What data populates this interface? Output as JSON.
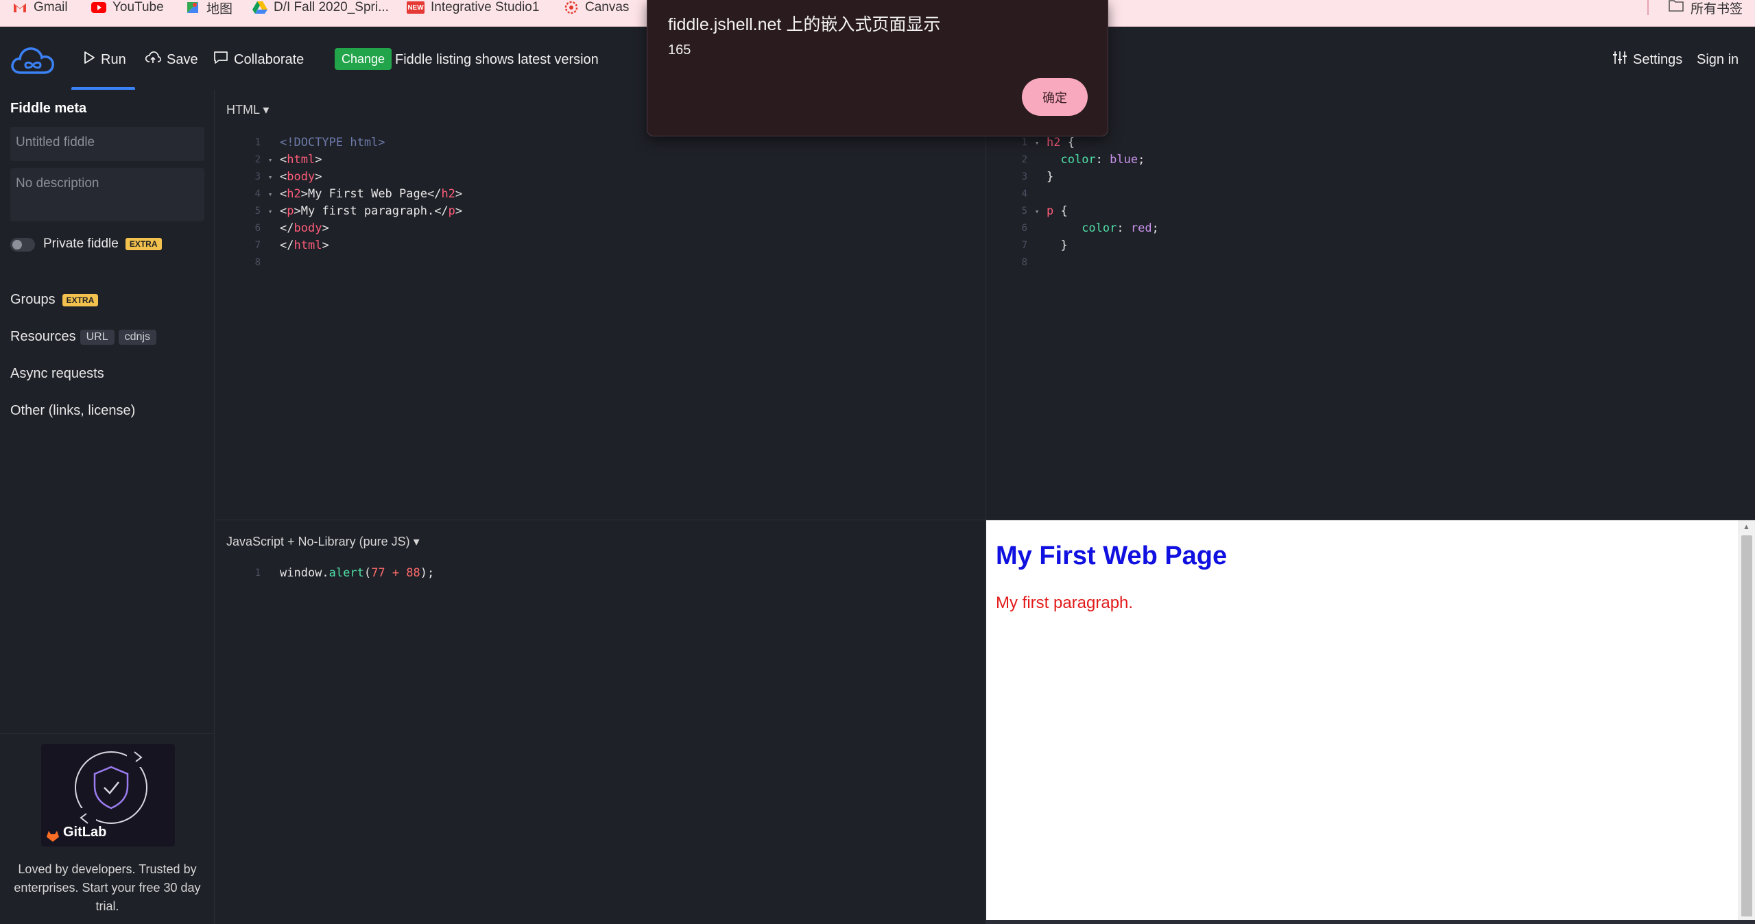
{
  "bookmarks": [
    {
      "label": "Gmail",
      "icon": "gmail-icon"
    },
    {
      "label": "YouTube",
      "icon": "youtube-icon"
    },
    {
      "label": "地图",
      "icon": "maps-icon"
    },
    {
      "label": "D/I Fall 2020_Spri...",
      "icon": "drive-icon"
    },
    {
      "label": "Integrative Studio1",
      "icon": "new-icon"
    },
    {
      "label": "Canvas",
      "icon": "canvas-icon"
    }
  ],
  "bookmarks_right": {
    "label": "所有书签",
    "icon": "folder-icon"
  },
  "nav": {
    "run": "Run",
    "save": "Save",
    "collaborate": "Collaborate",
    "change_badge": "Change",
    "change_text": "Fiddle listing shows latest version",
    "settings": "Settings",
    "sign_in": "Sign in"
  },
  "sidebar": {
    "title": "Fiddle meta",
    "title_placeholder": "Untitled fiddle",
    "description_placeholder": "No description",
    "private_label": "Private fiddle",
    "extra_badge": "EXTRA",
    "groups": "Groups",
    "resources": "Resources",
    "resources_chips": [
      "URL",
      "cdnjs"
    ],
    "async": "Async requests",
    "other": "Other (links, license)",
    "ad_brand": "GitLab",
    "ad_text": "Loved by developers. Trusted by enterprises. Start your free 30 day trial."
  },
  "html_pane": {
    "label": "HTML",
    "lines": [
      {
        "n": "1",
        "fold": "",
        "parts": [
          [
            "<!DOCTYPE html>",
            "t-doc"
          ]
        ]
      },
      {
        "n": "2",
        "fold": "▾",
        "parts": [
          [
            "<",
            ""
          ],
          [
            "html",
            "t-tag"
          ],
          [
            ">",
            ""
          ]
        ]
      },
      {
        "n": "3",
        "fold": "▾",
        "parts": [
          [
            "<",
            ""
          ],
          [
            "body",
            "t-tag"
          ],
          [
            ">",
            ""
          ]
        ]
      },
      {
        "n": "4",
        "fold": "▾",
        "parts": [
          [
            "<",
            ""
          ],
          [
            "h2",
            "t-tag"
          ],
          [
            ">My First Web Page</",
            ""
          ],
          [
            "h2",
            "t-tag"
          ],
          [
            ">",
            ""
          ]
        ]
      },
      {
        "n": "5",
        "fold": "▾",
        "parts": [
          [
            "<",
            ""
          ],
          [
            "p",
            "t-tag"
          ],
          [
            ">My first paragraph.</",
            ""
          ],
          [
            "p",
            "t-tag"
          ],
          [
            ">",
            ""
          ]
        ]
      },
      {
        "n": "6",
        "fold": "",
        "parts": [
          [
            "</",
            ""
          ],
          [
            "body",
            "t-tag"
          ],
          [
            ">",
            ""
          ]
        ]
      },
      {
        "n": "7",
        "fold": "",
        "parts": [
          [
            "</",
            ""
          ],
          [
            "html",
            "t-tag"
          ],
          [
            ">",
            ""
          ]
        ]
      },
      {
        "n": "8",
        "fold": "",
        "parts": []
      }
    ]
  },
  "css_pane": {
    "lines": [
      {
        "n": "1",
        "fold": "▾",
        "parts": [
          [
            "h2",
            "t-tag"
          ],
          [
            " {",
            ""
          ]
        ]
      },
      {
        "n": "2",
        "fold": "",
        "parts": [
          [
            "  ",
            ""
          ],
          [
            "color",
            "t-prop"
          ],
          [
            ": ",
            ""
          ],
          [
            "blue",
            "t-val"
          ],
          [
            ";",
            ""
          ]
        ]
      },
      {
        "n": "3",
        "fold": "",
        "parts": [
          [
            "}",
            ""
          ]
        ]
      },
      {
        "n": "4",
        "fold": "",
        "parts": []
      },
      {
        "n": "5",
        "fold": "▾",
        "parts": [
          [
            "p",
            "t-tag"
          ],
          [
            " {",
            ""
          ]
        ]
      },
      {
        "n": "6",
        "fold": "",
        "parts": [
          [
            "     ",
            ""
          ],
          [
            "color",
            "t-prop"
          ],
          [
            ": ",
            ""
          ],
          [
            "red",
            "t-val"
          ],
          [
            ";",
            ""
          ]
        ]
      },
      {
        "n": "7",
        "fold": "",
        "parts": [
          [
            "  }",
            ""
          ]
        ]
      },
      {
        "n": "8",
        "fold": "",
        "parts": []
      }
    ]
  },
  "js_pane": {
    "label": "JavaScript + No-Library (pure JS)",
    "lines": [
      {
        "n": "1",
        "fold": "",
        "parts": [
          [
            "window.",
            ""
          ],
          [
            "alert",
            "t-fn"
          ],
          [
            "(",
            ""
          ],
          [
            "77",
            "t-numv"
          ],
          [
            " + ",
            "t-numv"
          ],
          [
            "88",
            "t-numv"
          ],
          [
            ");",
            ""
          ]
        ]
      }
    ]
  },
  "result": {
    "heading": "My First Web Page",
    "paragraph": "My first paragraph."
  },
  "dialog": {
    "title": "fiddle.jshell.net 上的嵌入式页面显示",
    "message": "165",
    "ok": "确定"
  },
  "colors": {
    "accent": "#3b82f6",
    "change_badge": "#22a44a",
    "extra_badge": "#f2c14e",
    "result_heading": "#1010e0",
    "result_paragraph": "#e21a1a",
    "dialog_button": "#f9a9bd"
  }
}
